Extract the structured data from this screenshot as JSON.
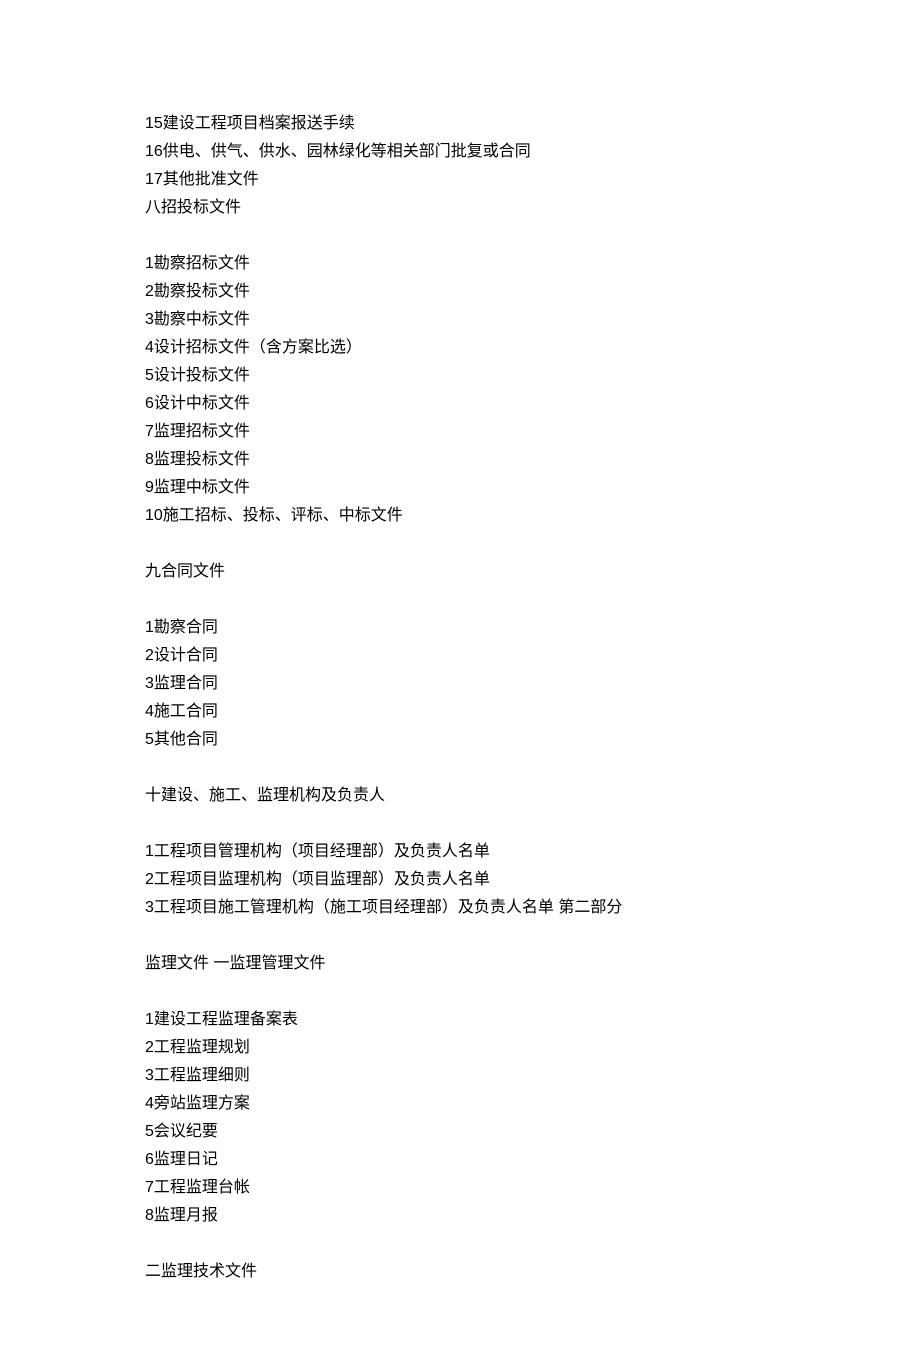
{
  "lines": [
    "15建设工程项目档案报送手续",
    "16供电、供气、供水、园林绿化等相关部门批复或合同",
    "17其他批准文件",
    "八招投标文件",
    "",
    "1勘察招标文件",
    "2勘察投标文件",
    "3勘察中标文件",
    "4设计招标文件（含方案比选）",
    "5设计投标文件",
    "6设计中标文件",
    "7监理招标文件",
    "8监理投标文件",
    "9监理中标文件",
    "10施工招标、投标、评标、中标文件",
    "",
    "九合同文件",
    "",
    "1勘察合同",
    "2设计合同",
    "3监理合同",
    "4施工合同",
    "5其他合同",
    "",
    "十建设、施工、监理机构及负责人",
    "",
    "1工程项目管理机构（项目经理部）及负责人名单",
    "2工程项目监理机构（项目监理部）及负责人名单",
    "3工程项目施工管理机构（施工项目经理部）及负责人名单  第二部分",
    "",
    "监理文件  一监理管理文件",
    "",
    "1建设工程监理备案表",
    "2工程监理规划",
    "3工程监理细则",
    "4旁站监理方案",
    "5会议纪要",
    "6监理日记",
    "7工程监理台帐",
    "8监理月报",
    "",
    "二监理技术文件"
  ]
}
